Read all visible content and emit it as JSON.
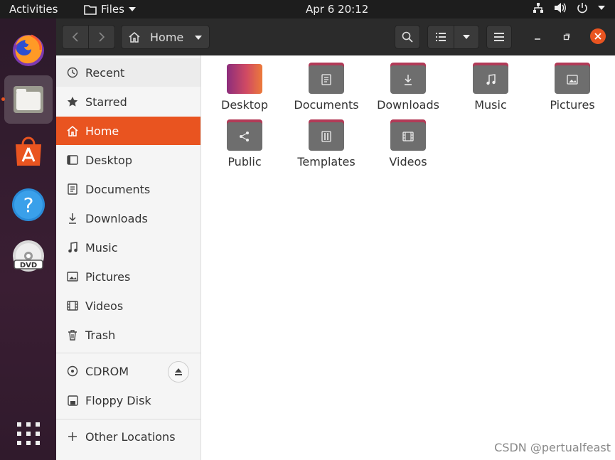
{
  "topbar": {
    "activities": "Activities",
    "app_name": "Files",
    "clock": "Apr 6  20:12"
  },
  "header": {
    "location": "Home"
  },
  "sidebar": {
    "items": [
      {
        "label": "Recent",
        "icon": "clock-icon"
      },
      {
        "label": "Starred",
        "icon": "star-icon"
      },
      {
        "label": "Home",
        "icon": "home-icon"
      },
      {
        "label": "Desktop",
        "icon": "desktop-icon"
      },
      {
        "label": "Documents",
        "icon": "document-icon"
      },
      {
        "label": "Downloads",
        "icon": "download-icon"
      },
      {
        "label": "Music",
        "icon": "music-icon"
      },
      {
        "label": "Pictures",
        "icon": "picture-icon"
      },
      {
        "label": "Videos",
        "icon": "video-icon"
      },
      {
        "label": "Trash",
        "icon": "trash-icon"
      }
    ],
    "devices": [
      {
        "label": "CDROM",
        "icon": "disc-icon"
      },
      {
        "label": "Floppy Disk",
        "icon": "floppy-icon"
      }
    ],
    "other": {
      "label": "Other Locations",
      "icon": "plus-icon"
    }
  },
  "files": [
    {
      "label": "Desktop",
      "icon": "desktop-folder-icon"
    },
    {
      "label": "Documents",
      "icon": "documents-folder-icon"
    },
    {
      "label": "Downloads",
      "icon": "downloads-folder-icon"
    },
    {
      "label": "Music",
      "icon": "music-folder-icon"
    },
    {
      "label": "Pictures",
      "icon": "pictures-folder-icon"
    },
    {
      "label": "Public",
      "icon": "public-folder-icon"
    },
    {
      "label": "Templates",
      "icon": "templates-folder-icon"
    },
    {
      "label": "Videos",
      "icon": "videos-folder-icon"
    }
  ],
  "watermark": "CSDN @pertualfeast",
  "colors": {
    "accent": "#e95420",
    "folder_tab": "#b23a57",
    "folder_body": "#6e6e6e"
  }
}
